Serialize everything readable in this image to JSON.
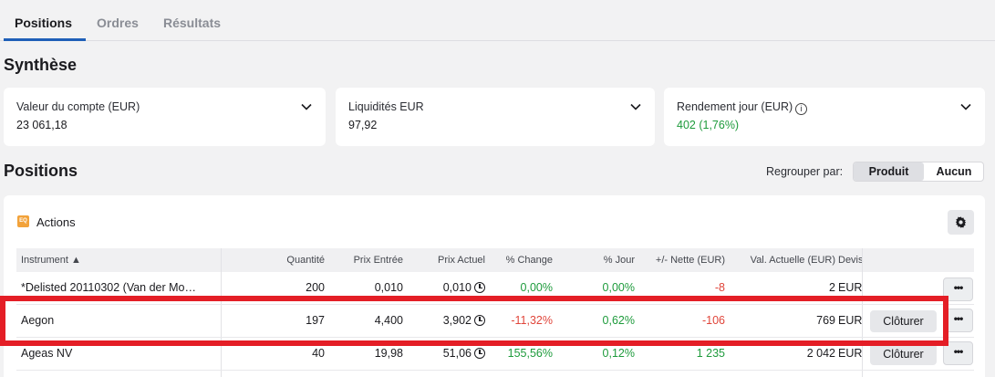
{
  "tabs": [
    {
      "label": "Positions",
      "active": true
    },
    {
      "label": "Ordres",
      "active": false
    },
    {
      "label": "Résultats",
      "active": false
    }
  ],
  "synthese": {
    "title": "Synthèse",
    "cards": [
      {
        "label": "Valeur du compte (EUR)",
        "value": "23 061,18"
      },
      {
        "label": "Liquidités EUR",
        "value": "97,92"
      },
      {
        "label": "Rendement jour (EUR)",
        "value": "402 (1,76%)"
      }
    ]
  },
  "positions": {
    "title": "Positions",
    "group_label": "Regrouper par:",
    "group_options": [
      "Produit",
      "Aucun"
    ],
    "group_selected": "Produit"
  },
  "panel": {
    "icon_text": "EQ",
    "title": "Actions"
  },
  "table": {
    "headers": [
      "Instrument ▲",
      "Quantité",
      "Prix Entrée",
      "Prix Actuel",
      "% Change",
      "% Jour",
      "+/- Nette (EUR)",
      "Val. Actuelle (EUR)",
      "Devis"
    ],
    "rows": [
      {
        "instrument": "*Delisted 20110302 (Van der Mo…",
        "quantite": "200",
        "prix_entree": "0,010",
        "prix_actuel": "0,010",
        "change": "0,00%",
        "jour": "0,00%",
        "nette": "-8",
        "valeur": "2",
        "devise": "EUR",
        "action": ""
      },
      {
        "instrument": "Aegon",
        "quantite": "197",
        "prix_entree": "4,400",
        "prix_actuel": "3,902",
        "change": "-11,32%",
        "jour": "0,62%",
        "nette": "-106",
        "valeur": "769",
        "devise": "EUR",
        "action": "Clôturer"
      },
      {
        "instrument": "Ageas NV",
        "quantite": "40",
        "prix_entree": "19,98",
        "prix_actuel": "51,06",
        "change": "155,56%",
        "jour": "0,12%",
        "nette": "1 235",
        "valeur": "2 042",
        "devise": "EUR",
        "action": "Clôturer"
      }
    ],
    "more_label": "•••"
  },
  "colors": {
    "accent": "#1f5fb8",
    "positive": "#1e9b3c",
    "negative": "#e0453a",
    "highlight": "#e41e26"
  }
}
